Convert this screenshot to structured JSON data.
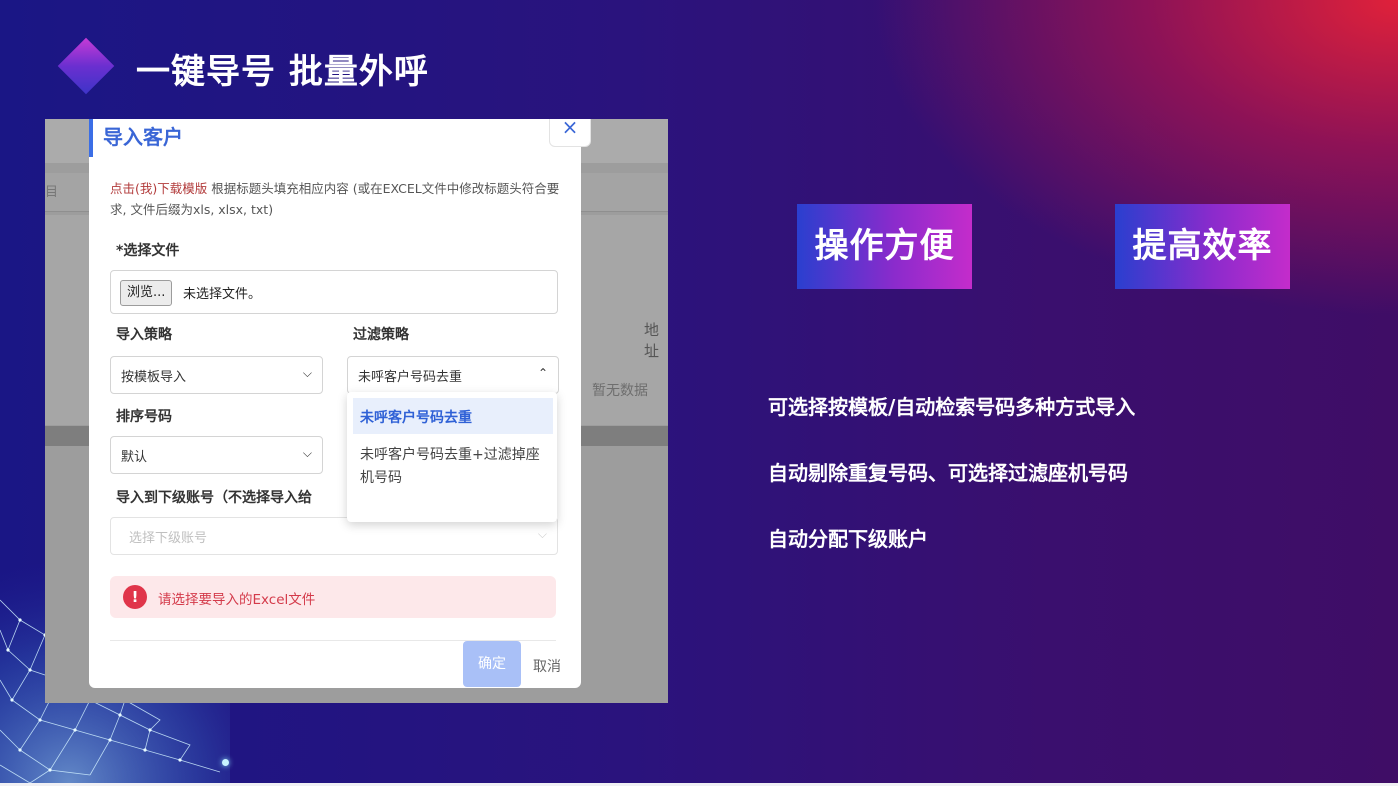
{
  "slide": {
    "title": "一键导号 批量外呼",
    "badges": [
      "操作方便",
      "提高效率"
    ],
    "features": [
      "可选择按模板/自动检索号码多种方式导入",
      "自动剔除重复号码、可选择过滤座机号码",
      "自动分配下级账户"
    ]
  },
  "background_app": {
    "left_fragment": "目",
    "column_header_fragment": "地址",
    "empty_text": "暂无数据"
  },
  "dialog": {
    "title": "导入客户",
    "close_symbol": "×",
    "hint_link": "点击(我)下载模版",
    "hint_text": " 根据标题头填充相应内容 (或在EXCEL文件中修改标题头符合要求, 文件后缀为xls, xlsx, txt)",
    "file_label": "*选择文件",
    "browse_button": "浏览...",
    "file_status": "未选择文件。",
    "import_strategy_label": "导入策略",
    "import_strategy_value": "按模板导入",
    "filter_strategy_label": "过滤策略",
    "filter_strategy_value": "未呼客户号码去重",
    "filter_options": [
      "未呼客户号码去重",
      "未呼客户号码去重+过滤掉座机号码"
    ],
    "sort_label": "排序号码",
    "sort_value": "默认",
    "sub_account_label": "导入到下级账号（不选择导入给",
    "sub_account_placeholder": "选择下级账号",
    "alert_icon": "!",
    "alert_text": "请选择要导入的Excel文件",
    "confirm_button": "确定",
    "cancel_button": "取消"
  },
  "colors": {
    "accent_blue": "#3a66d6",
    "error_red": "#d43a4a",
    "badge_gradient_start": "#2a3fcf",
    "badge_gradient_end": "#c42ccb"
  }
}
